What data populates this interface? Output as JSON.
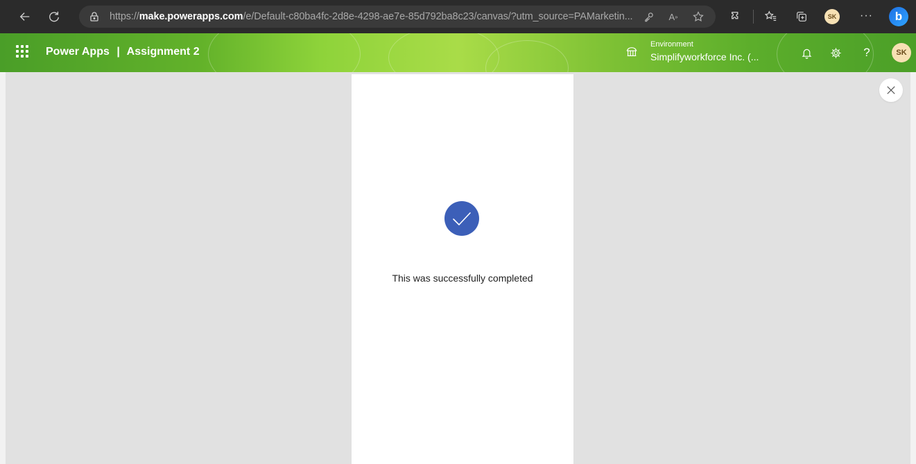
{
  "browser": {
    "url_prefix": "https://",
    "url_host": "make.powerapps.com",
    "url_path": "/e/Default-c80ba4fc-2d8e-4298-ae7e-85d792ba8c23/canvas/?utm_source=PAMarketin...",
    "profile_initials": "SK",
    "more_label": "···",
    "copilot_label": "b"
  },
  "header": {
    "app_name": "Power Apps",
    "separator": "|",
    "app_title": "Assignment 2",
    "environment_label": "Environment",
    "environment_value": "Simplifyworkforce Inc. (...",
    "help_label": "?",
    "user_initials": "SK"
  },
  "main": {
    "success_message": "This was successfully completed"
  },
  "colors": {
    "header_green": "#63b22a",
    "check_blue": "#3c5fb8",
    "browser_dark": "#2b2b2b"
  }
}
